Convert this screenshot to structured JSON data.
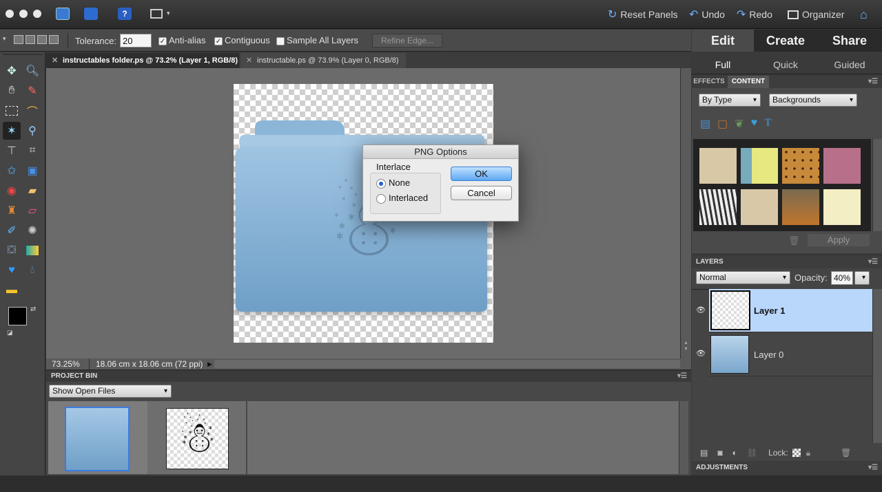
{
  "topbar": {
    "reset_panels": "Reset Panels",
    "undo": "Undo",
    "redo": "Redo",
    "organizer": "Organizer"
  },
  "options": {
    "tolerance_label": "Tolerance:",
    "tolerance_value": "20",
    "anti_alias": "Anti-alias",
    "contiguous": "Contiguous",
    "sample_all_layers": "Sample All Layers",
    "refine_edge": "Refine Edge..."
  },
  "doc_tabs": [
    {
      "label": "instructables folder.ps @ 73.2% (Layer 1, RGB/8)",
      "active": true
    },
    {
      "label": "instructable.ps @ 73.9% (Layer 0, RGB/8)",
      "active": false
    }
  ],
  "dialog": {
    "title": "PNG Options",
    "group_label": "Interlace",
    "option_none": "None",
    "option_interlaced": "Interlaced",
    "ok": "OK",
    "cancel": "Cancel"
  },
  "status": {
    "zoom": "73.25%",
    "doc_size": "18.06 cm x 18.06 cm (72 ppi)"
  },
  "project_bin": {
    "title": "PROJECT BIN",
    "show": "Show Open Files"
  },
  "right": {
    "tabs": [
      "Edit",
      "Create",
      "Share"
    ],
    "subtabs": [
      "Full",
      "Quick",
      "Guided"
    ],
    "effects_tab": "EFFECTS",
    "content_tab": "CONTENT",
    "by_type": "By Type",
    "backgrounds": "Backgrounds",
    "apply": "Apply",
    "layers_title": "LAYERS",
    "blend_mode": "Normal",
    "opacity_label": "Opacity:",
    "opacity_value": "40%",
    "layers": [
      {
        "name": "Layer 1",
        "selected": true
      },
      {
        "name": "Layer 0",
        "selected": false
      }
    ],
    "lock_label": "Lock:",
    "adjustments_title": "ADJUSTMENTS"
  },
  "colors": {
    "accent_blue": "#b9d6fb",
    "ok_blue": "#5ea8f3",
    "folder_blue": "#8db7d9"
  }
}
